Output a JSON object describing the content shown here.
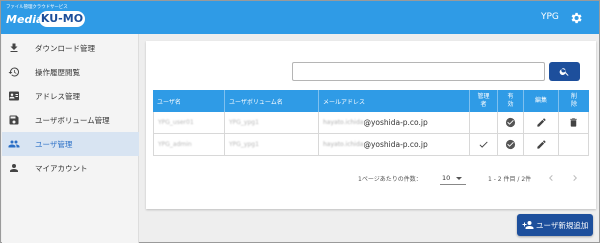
{
  "header": {
    "logo_subtitle": "ファイル管理クラウドサービス",
    "logo_media": "Media",
    "logo_kumo": "KU-MO",
    "user_label": "YPG",
    "settings_icon": "gear-icon",
    "background": "#2f9be6"
  },
  "sidebar": {
    "items": [
      {
        "label": "ダウンロード管理",
        "icon": "download-icon",
        "active": false
      },
      {
        "label": "操作履歴閲覧",
        "icon": "history-icon",
        "active": false
      },
      {
        "label": "アドレス管理",
        "icon": "contact-card-icon",
        "active": false
      },
      {
        "label": "ユーザボリューム管理",
        "icon": "save-icon",
        "active": false
      },
      {
        "label": "ユーザ管理",
        "icon": "people-icon",
        "active": true
      },
      {
        "label": "マイアカウント",
        "icon": "person-icon",
        "active": false
      }
    ]
  },
  "search": {
    "value": "",
    "placeholder": "",
    "button_icon": "search-icon"
  },
  "table": {
    "headers": {
      "user_name": "ユーザ名",
      "user_volume": "ユーザボリューム名",
      "email": "メールアドレス",
      "admin_line1": "管理",
      "admin_line2": "者",
      "enabled_line1": "有",
      "enabled_line2": "効",
      "edit": "編集",
      "delete_line1": "削",
      "delete_line2": "除"
    },
    "rows": [
      {
        "user_name": "YPG_user01",
        "user_volume": "YPG_ypg1",
        "email_local": "hayato.ichida",
        "email_domain": "@yoshida-p.co.jp",
        "admin": false,
        "enabled": true,
        "editable": true,
        "deletable": true
      },
      {
        "user_name": "YPG_admin",
        "user_volume": "YPG_ypg1",
        "email_local": "hayato.ichida",
        "email_domain": "@yoshida-p.co.jp",
        "admin": true,
        "enabled": true,
        "editable": true,
        "deletable": false
      }
    ]
  },
  "pagination": {
    "per_page_label": "1ページあたりの件数：",
    "per_page_value": "10",
    "range_label": "1 - 2 件目 / 2件"
  },
  "actions": {
    "add_user_label": "ユーザ新規追加",
    "add_user_icon": "person-add-icon",
    "accent": "#1d4f9c"
  }
}
